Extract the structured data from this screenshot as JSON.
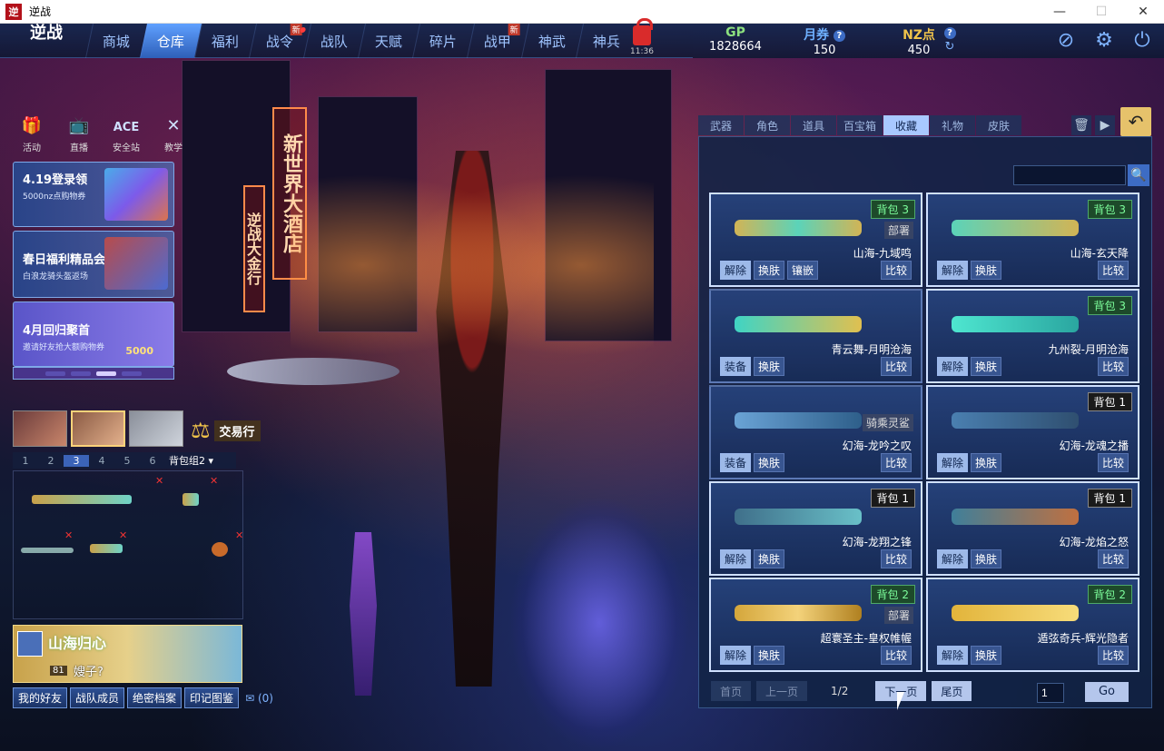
{
  "window": {
    "title": "逆战",
    "app_icon_text": "逆",
    "minimize": "—",
    "maximize": "☐",
    "close": "✕"
  },
  "logo": {
    "text": "逆战",
    "sub": ""
  },
  "nav": {
    "tabs": [
      {
        "label": "商城",
        "badge": "",
        "dot": false
      },
      {
        "label": "仓库",
        "badge": "",
        "dot": false,
        "active": true
      },
      {
        "label": "福利",
        "badge": "",
        "dot": false
      },
      {
        "label": "战令",
        "badge": "新",
        "dot": true
      },
      {
        "label": "战队",
        "badge": "",
        "dot": false
      },
      {
        "label": "天赋",
        "badge": "",
        "dot": false
      },
      {
        "label": "碎片",
        "badge": "",
        "dot": false
      },
      {
        "label": "战甲",
        "badge": "新",
        "dot": false
      },
      {
        "label": "神武",
        "badge": "",
        "dot": false
      },
      {
        "label": "神兵",
        "badge": "",
        "dot": false
      }
    ],
    "time": "11:36"
  },
  "currency": {
    "gp_label": "GP",
    "gp_value": "1828664",
    "ticket_label": "月券",
    "ticket_value": "150",
    "nz_label": "NZ点",
    "nz_value": "450",
    "help": "?",
    "refresh": "↻"
  },
  "quicklinks": [
    {
      "label": "活动",
      "icon": "gift-icon"
    },
    {
      "label": "直播",
      "icon": "tv-icon"
    },
    {
      "label": "安全站",
      "icon": "ace-icon",
      "glyph": "ACE"
    },
    {
      "label": "教学",
      "icon": "cross-icon"
    }
  ],
  "banners": [
    {
      "title": "4.19登录领",
      "sub": "5000nz点购物券"
    },
    {
      "title": "春日福利精品会",
      "sub": "白浪龙骑头盔返场"
    },
    {
      "title": "4月回归聚首",
      "sub": "邀请好友抢大额购物券",
      "amount": "5000"
    }
  ],
  "loadout": {
    "slots": [
      "1",
      "2",
      "3",
      "4",
      "5",
      "6"
    ],
    "selected_slot": "3",
    "bag_group": "背包组2",
    "trade": "交易行"
  },
  "profile": {
    "banner_title": "山海归心",
    "level": "81",
    "nickname": "嫂子?"
  },
  "bottom_buttons": [
    "我的好友",
    "战队成员",
    "绝密档案",
    "印记图鉴"
  ],
  "mail_count": "(0)",
  "panel": {
    "cat_tabs": [
      "武器",
      "角色",
      "道具",
      "百宝箱",
      "收藏",
      "礼物",
      "皮肤"
    ],
    "active_tab": "收藏",
    "search_value": "",
    "undo": "↶",
    "trash": "🗑",
    "camera": "▶"
  },
  "items": [
    {
      "name": "山海-九域鸣",
      "bag": "背包 3",
      "bag_style": "green",
      "tag": "部署",
      "buttons": [
        "解除",
        "换肤",
        "镶嵌"
      ],
      "highlight": 0,
      "compare": "比较",
      "gun_color": "linear-gradient(90deg,#d2b455,#5bd3b9,#d2b455)"
    },
    {
      "name": "山海-玄天降",
      "bag": "背包 3",
      "bag_style": "green",
      "tag": "",
      "buttons": [
        "解除",
        "换肤"
      ],
      "highlight": 0,
      "compare": "比较",
      "gun_color": "linear-gradient(90deg,#5bd3b9,#d2b455)"
    },
    {
      "name": "青云舞-月明沧海",
      "bag": "",
      "bag_style": "",
      "tag": "",
      "buttons": [
        "装备",
        "换肤"
      ],
      "highlight": 0,
      "compare": "比较",
      "gun_color": "linear-gradient(90deg,#3fd4c4,#e0c050)"
    },
    {
      "name": "九州裂-月明沧海",
      "bag": "背包 3",
      "bag_style": "green",
      "tag": "",
      "buttons": [
        "解除",
        "换肤"
      ],
      "highlight": 0,
      "compare": "比较",
      "gun_color": "linear-gradient(90deg,#4ee6d0,#2aa6a0)"
    },
    {
      "name": "幻海-龙吟之叹",
      "bag": "",
      "bag_style": "",
      "tag": "骑乘灵鲨",
      "buttons": [
        "装备",
        "换肤"
      ],
      "highlight": 0,
      "compare": "比较",
      "gun_color": "linear-gradient(90deg,#6aa3d6,#2e5f8a)"
    },
    {
      "name": "幻海-龙魂之播",
      "bag": "背包 1",
      "bag_style": "plain",
      "tag": "",
      "buttons": [
        "解除",
        "换肤"
      ],
      "highlight": 0,
      "compare": "比较",
      "gun_color": "linear-gradient(90deg,#4a7fb0,#2f4f70)"
    },
    {
      "name": "幻海-龙翔之锋",
      "bag": "背包 1",
      "bag_style": "plain",
      "tag": "",
      "buttons": [
        "解除",
        "换肤"
      ],
      "highlight": 0,
      "compare": "比较",
      "gun_color": "linear-gradient(90deg,#3f6f8a,#69c0c8)"
    },
    {
      "name": "幻海-龙焰之怒",
      "bag": "背包 1",
      "bag_style": "plain",
      "tag": "",
      "buttons": [
        "解除",
        "换肤"
      ],
      "highlight": 0,
      "compare": "比较",
      "gun_color": "linear-gradient(90deg,#3f7f9a,#c07040)"
    },
    {
      "name": "超寰圣主-皇权帷幄",
      "bag": "背包 2",
      "bag_style": "green",
      "tag": "部署",
      "buttons": [
        "解除",
        "换肤"
      ],
      "highlight": 0,
      "compare": "比较",
      "gun_color": "linear-gradient(90deg,#d4a63b,#f3d27a,#b08020)"
    },
    {
      "name": "遁弦奇兵-辉光隐者",
      "bag": "背包 2",
      "bag_style": "green",
      "tag": "",
      "buttons": [
        "解除",
        "换肤"
      ],
      "highlight": 0,
      "compare": "比较",
      "gun_color": "linear-gradient(90deg,#e2b43b,#f7dc7a)"
    }
  ],
  "pager": {
    "first": "首页",
    "prev": "上一页",
    "info": "1/2",
    "next": "下一页",
    "last": "尾页",
    "input": "1",
    "go": "Go"
  },
  "scene_signs": [
    "新世界大酒店",
    "逆战大金行"
  ]
}
